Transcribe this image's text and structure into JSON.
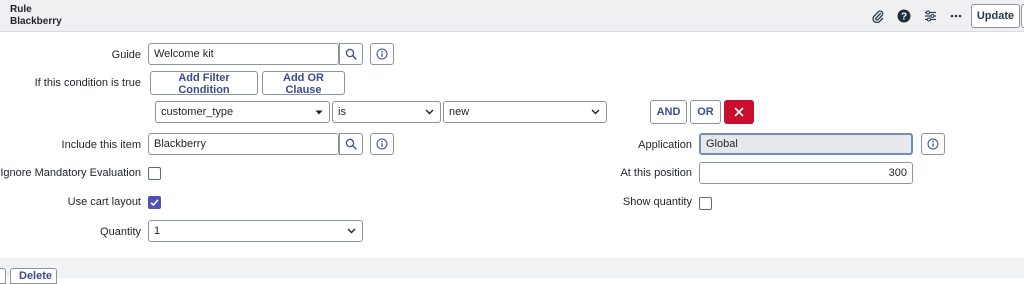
{
  "header": {
    "title_line1": "Rule",
    "title_line2": "Blackberry",
    "update_label": "Update"
  },
  "form": {
    "guide": {
      "label": "Guide",
      "value": "Welcome kit"
    },
    "condition": {
      "label": "If this condition is true",
      "add_filter_label": "Add Filter Condition",
      "add_or_label": "Add OR Clause",
      "field": "customer_type",
      "operator": "is",
      "value": "new",
      "and_label": "AND",
      "or_label": "OR"
    },
    "include": {
      "label": "Include this item",
      "value": "Blackberry"
    },
    "ignore_mandatory": {
      "label": "Ignore Mandatory Evaluation",
      "checked": false
    },
    "use_cart_layout": {
      "label": "Use cart layout",
      "checked": true
    },
    "quantity": {
      "label": "Quantity",
      "value": "1"
    },
    "application": {
      "label": "Application",
      "value": "Global"
    },
    "position": {
      "label": "At this position",
      "value": "300"
    },
    "show_quantity": {
      "label": "Show quantity",
      "checked": false
    }
  },
  "footer": {
    "delete_label": "Delete"
  },
  "icons": [
    "paperclip-icon",
    "help-icon",
    "settings-icon",
    "more-icon",
    "search-icon",
    "info-icon",
    "close-icon",
    "chevron-down-icon",
    "check-icon"
  ],
  "colors": {
    "primary": "#4f52b2",
    "danger": "#c8102e",
    "text": "#1f2328"
  }
}
